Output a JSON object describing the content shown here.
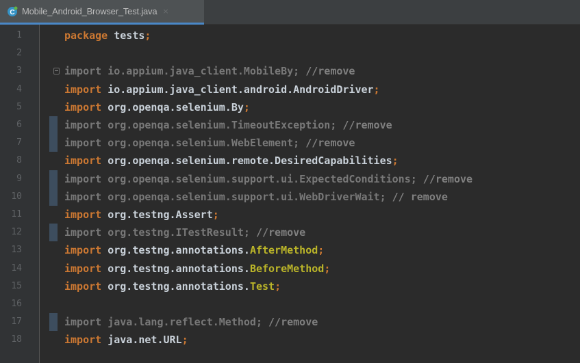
{
  "editor_tab": {
    "icon": "java-class-icon",
    "label": "Mobile_Android_Browser_Test.java",
    "close": "×"
  },
  "colors": {
    "keyword": "#cc7832",
    "identifier": "#c9d1d9",
    "annotation": "#bbb529",
    "unused": "#787878",
    "line_number": "#606366",
    "background": "#2b2b2b",
    "tab_accent": "#4a88c7"
  },
  "lines": [
    {
      "number": "1",
      "keyword": "package",
      "path": "tests",
      "suffix": ";",
      "comment": ""
    },
    {
      "number": "2",
      "keyword": "",
      "path": "",
      "suffix": "",
      "comment": ""
    },
    {
      "number": "3",
      "keyword": "import",
      "path": "io.appium.java_client.MobileBy",
      "suffix": ";",
      "comment": " //remove"
    },
    {
      "number": "4",
      "keyword": "import",
      "path": "io.appium.java_client.android.AndroidDriver",
      "suffix": ";",
      "comment": ""
    },
    {
      "number": "5",
      "keyword": "import",
      "path": "org.openqa.selenium.By",
      "suffix": ";",
      "comment": ""
    },
    {
      "number": "6",
      "keyword": "import",
      "path": "org.openqa.selenium.TimeoutException",
      "suffix": ";",
      "comment": " //remove"
    },
    {
      "number": "7",
      "keyword": "import",
      "path": "org.openqa.selenium.WebElement",
      "suffix": ";",
      "comment": " //remove"
    },
    {
      "number": "8",
      "keyword": "import",
      "path": "org.openqa.selenium.remote.DesiredCapabilities",
      "suffix": ";",
      "comment": ""
    },
    {
      "number": "9",
      "keyword": "import",
      "path": "org.openqa.selenium.support.ui.ExpectedConditions",
      "suffix": ";",
      "comment": " //remove"
    },
    {
      "number": "10",
      "keyword": "import",
      "path": "org.openqa.selenium.support.ui.WebDriverWait",
      "suffix": ";",
      "comment": " // remove"
    },
    {
      "number": "11",
      "keyword": "import",
      "path": "org.testng.Assert",
      "suffix": ";",
      "comment": ""
    },
    {
      "number": "12",
      "keyword": "import",
      "path": "org.testng.ITestResult",
      "suffix": ";",
      "comment": " //remove"
    },
    {
      "number": "13",
      "keyword": "import",
      "path": "org.testng.annotations.",
      "annotation": "AfterMethod",
      "suffix": ";",
      "comment": ""
    },
    {
      "number": "14",
      "keyword": "import",
      "path": "org.testng.annotations.",
      "annotation": "BeforeMethod",
      "suffix": ";",
      "comment": ""
    },
    {
      "number": "15",
      "keyword": "import",
      "path": "org.testng.annotations.",
      "annotation": "Test",
      "suffix": ";",
      "comment": ""
    },
    {
      "number": "16",
      "keyword": "",
      "path": "",
      "suffix": "",
      "comment": ""
    },
    {
      "number": "17",
      "keyword": "import",
      "path": "java.lang.reflect.Method",
      "suffix": ";",
      "comment": " //remove"
    },
    {
      "number": "18",
      "keyword": "import",
      "path": "java.net.URL",
      "suffix": ";",
      "comment": ""
    }
  ]
}
